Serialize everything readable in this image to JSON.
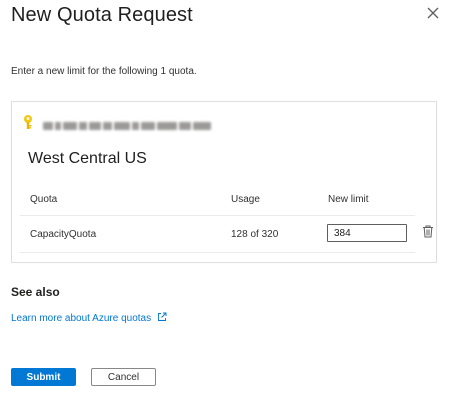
{
  "dialog": {
    "title": "New Quota Request",
    "intro": "Enter a new limit for the following 1 quota."
  },
  "quota_panel": {
    "region": "West Central US",
    "columns": {
      "quota": "Quota",
      "usage": "Usage",
      "new_limit": "New limit"
    },
    "rows": [
      {
        "quota": "CapacityQuota",
        "usage": "128 of 320",
        "new_limit": "384"
      }
    ]
  },
  "see_also": {
    "heading": "See also",
    "link_label": "Learn more about Azure quotas"
  },
  "actions": {
    "submit_label": "Submit",
    "cancel_label": "Cancel"
  },
  "colors": {
    "accent": "#0078d4",
    "key_icon": "#f2c811"
  },
  "icons": [
    "close-icon",
    "key-icon",
    "trash-icon",
    "external-link-icon"
  ]
}
